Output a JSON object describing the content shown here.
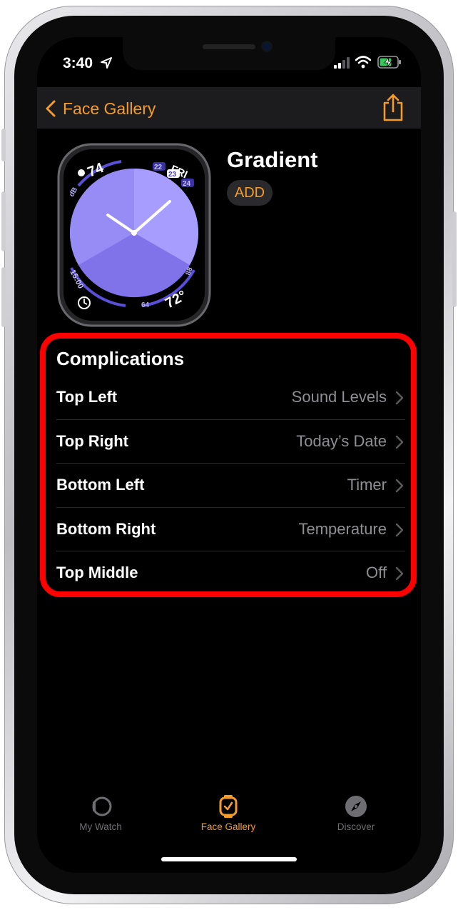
{
  "status_bar": {
    "time": "3:40"
  },
  "nav": {
    "back_label": "Face Gallery"
  },
  "watch_face": {
    "name": "Gradient",
    "add_label": "ADD",
    "complications_preview": {
      "top_left": "74",
      "top_right_day": "FRI",
      "top_right_dates": [
        "22",
        "23",
        "24"
      ],
      "bottom_left": "15:00",
      "bottom_right_range": [
        "64",
        "88"
      ],
      "bottom_right_temp": "72°",
      "gauge_label": "dB"
    },
    "colors": {
      "gradient_light": "#a79cff",
      "gradient_dark": "#6d61e0",
      "accent": "#f39c2b"
    }
  },
  "complications": {
    "header": "Complications",
    "items": [
      {
        "label": "Top Left",
        "value": "Sound Levels"
      },
      {
        "label": "Top Right",
        "value": "Today’s Date"
      },
      {
        "label": "Bottom Left",
        "value": "Timer"
      },
      {
        "label": "Bottom Right",
        "value": "Temperature"
      },
      {
        "label": "Top Middle",
        "value": "Off"
      }
    ]
  },
  "tabbar": {
    "tabs": [
      {
        "label": "My Watch",
        "icon": "watch-icon",
        "active": false
      },
      {
        "label": "Face Gallery",
        "icon": "watch-face-icon",
        "active": true
      },
      {
        "label": "Discover",
        "icon": "compass-icon",
        "active": false
      }
    ]
  },
  "annotation": {
    "highlight_color": "#ff0000"
  }
}
